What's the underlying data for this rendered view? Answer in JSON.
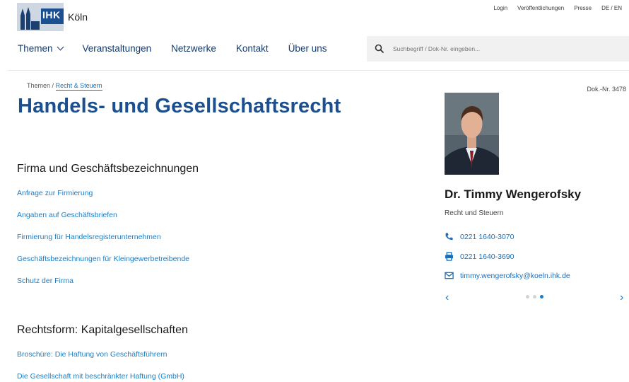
{
  "header": {
    "logo_text": "IHK",
    "city": "Köln",
    "top_links": [
      "Login",
      "Veröffentlichungen",
      "Presse",
      "DE / EN"
    ],
    "nav": [
      "Themen",
      "Veranstaltungen",
      "Netzwerke",
      "Kontakt",
      "Über uns"
    ],
    "search_placeholder": "Suchbegriff / Dok-Nr. eingeben..."
  },
  "breadcrumb": {
    "root": "Themen",
    "separator": "/",
    "current": "Recht & Steuern"
  },
  "doc_nr": "Dok.-Nr. 3478",
  "page_title": "Handels- und Gesellschaftsrecht",
  "sections": [
    {
      "heading": "Firma und Geschäftsbezeichnungen",
      "links": [
        "Anfrage zur Firmierung",
        "Angaben auf Geschäftsbriefen",
        "Firmierung für Handelsregisterunternehmen",
        "Geschäftsbezeichnungen für Kleingewerbetreibende",
        "Schutz der Firma"
      ]
    },
    {
      "heading": "Rechtsform: Kapitalgesellschaften",
      "links": [
        "Broschüre: Die Haftung von Geschäftsführern",
        "Die Gesellschaft mit beschränkter Haftung (GmbH)"
      ]
    }
  ],
  "contact": {
    "name": "Dr. Timmy Wengerofsky",
    "department": "Recht und Steuern",
    "phone": "0221 1640-3070",
    "fax": "0221 1640-3690",
    "email": "timmy.wengerofsky@koeln.ihk.de",
    "carousel_index": 3,
    "carousel_total": 3
  },
  "colors": {
    "brand_blue": "#1b4f8f",
    "link_blue": "#1b7fc6"
  }
}
